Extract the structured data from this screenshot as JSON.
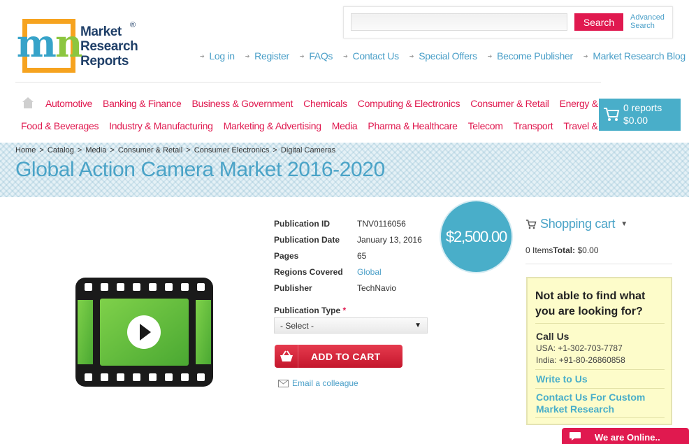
{
  "logo": {
    "line1": "Market",
    "line2": "Research",
    "line3": "Reports",
    "reg": "®"
  },
  "search": {
    "button": "Search",
    "advanced_line1": "Advanced",
    "advanced_line2": "Search",
    "placeholder": ""
  },
  "top_links": [
    "Log in",
    "Register",
    "FAQs",
    "Contact Us",
    "Special Offers",
    "Become Publisher",
    "Market Research Blog"
  ],
  "categories_row1": [
    "Automotive",
    "Banking & Finance",
    "Business & Government",
    "Chemicals",
    "Computing & Electronics",
    "Consumer & Retail",
    "Energy & Utilities"
  ],
  "categories_row2": [
    "Food & Beverages",
    "Industry & Manufacturing",
    "Marketing & Advertising",
    "Media",
    "Pharma & Healthcare",
    "Telecom",
    "Transport",
    "Travel & Leisure"
  ],
  "cart": {
    "count": "0 reports",
    "total": "$0.00"
  },
  "breadcrumb": [
    "Home",
    "Catalog",
    "Media",
    "Consumer & Retail",
    "Consumer Electronics",
    "Digital Cameras"
  ],
  "page_title": "Global Action Camera Market 2016-2020",
  "product": {
    "details": [
      {
        "label": "Publication ID",
        "value": "TNV0116056"
      },
      {
        "label": "Publication Date",
        "value": "January 13, 2016"
      },
      {
        "label": "Pages",
        "value": "65"
      },
      {
        "label": "Regions Covered",
        "value": "Global"
      },
      {
        "label": "Publisher",
        "value": "TechNavio"
      }
    ],
    "price": "$2,500.00",
    "publication_type_label": "Publication Type",
    "required_mark": "*",
    "select_value": "- Select -",
    "add_to_cart": "ADD TO CART",
    "email_colleague": "Email a colleague"
  },
  "sidebar": {
    "cart_title": "Shopping cart",
    "items_text": "0 Items",
    "total_label": "Total:",
    "total_value": "$0.00",
    "help": {
      "title_line1": "Not able to find what",
      "title_line2": "you are looking for?",
      "call_us": "Call Us",
      "usa": "USA: +1-302-703-7787",
      "india": "India: +91-80-26860858",
      "write": "Write to Us",
      "custom_line1": "Contact Us For Custom",
      "custom_line2": "Market Research"
    }
  },
  "chat": {
    "label": "We are Online.."
  },
  "colors": {
    "accent_pink": "#e0194f",
    "accent_blue": "#49aec9",
    "logo_orange": "#f6a31f",
    "logo_green": "#8cc63f"
  }
}
